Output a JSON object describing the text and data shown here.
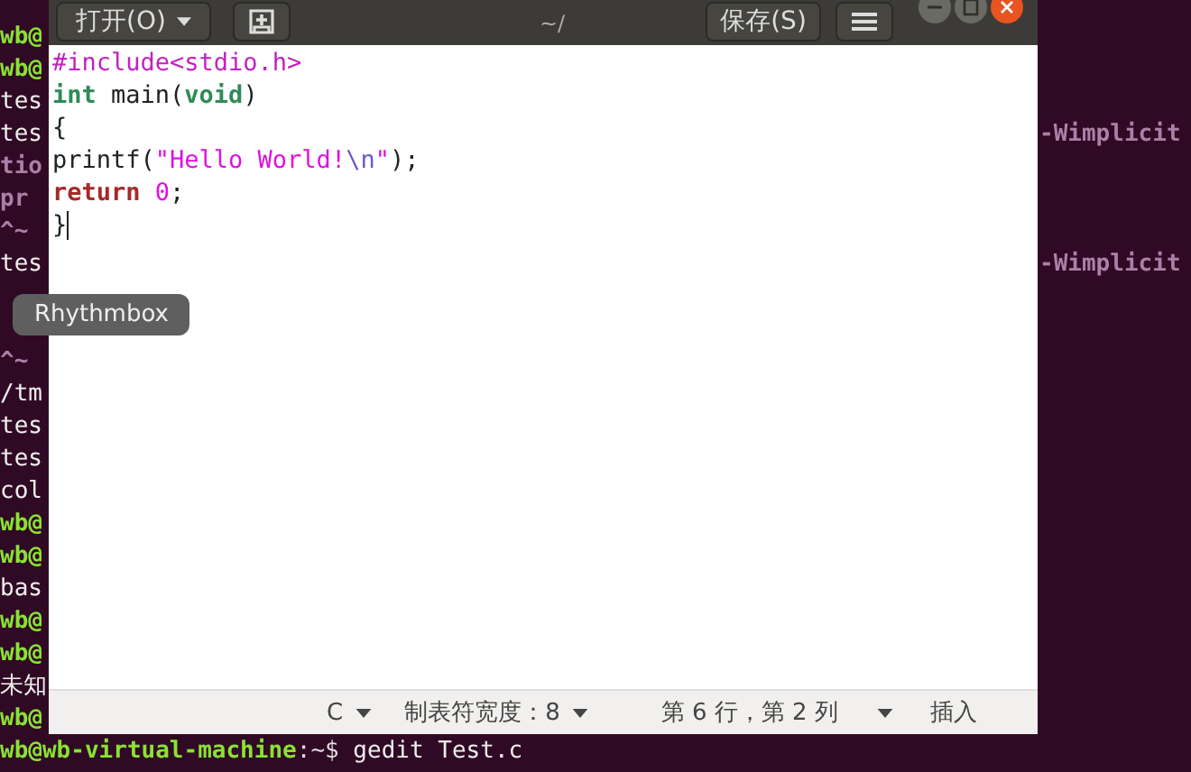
{
  "terminal": {
    "lines": [
      {
        "left": "wb@",
        "kind": "prompt"
      },
      {
        "left": "wb@",
        "kind": "prompt"
      },
      {
        "left": "tes",
        "kind": "text"
      },
      {
        "left": "tes",
        "kind": "text",
        "right": "-Wimplicit"
      },
      {
        "left": "tio",
        "kind": "warning"
      },
      {
        "left": "pr",
        "kind": "warning"
      },
      {
        "left": "^~",
        "kind": "warning"
      },
      {
        "left": "tes",
        "kind": "text",
        "right": "-Wimplicit"
      }
    ],
    "lines_below_tooltip": [
      {
        "left": "^~",
        "kind": "warning"
      },
      {
        "left": "/tm",
        "kind": "text"
      },
      {
        "left": "tes",
        "kind": "text"
      },
      {
        "left": "tes",
        "kind": "text"
      },
      {
        "left": "col",
        "kind": "text"
      },
      {
        "left": "wb@",
        "kind": "prompt"
      },
      {
        "left": "wb@",
        "kind": "prompt"
      },
      {
        "left": "bas",
        "kind": "text"
      },
      {
        "left": "wb@",
        "kind": "prompt"
      },
      {
        "left": "wb@",
        "kind": "prompt"
      },
      {
        "left": "未知",
        "kind": "text"
      },
      {
        "left": "wb@",
        "kind": "prompt"
      }
    ],
    "bottom_line": [
      {
        "text": "wb@wb-virtual-machine",
        "kind": "prompt"
      },
      {
        "text": ":~$",
        "kind": "path"
      },
      {
        "text": " gedit Test.c",
        "kind": "text"
      }
    ]
  },
  "gedit": {
    "open_button": "打开(O)",
    "subtitle": "~/",
    "save_button": "保存(S)",
    "code": [
      {
        "tokens": [
          {
            "text": "#include<stdio.h>",
            "kind": "preproc"
          }
        ]
      },
      {
        "tokens": [
          {
            "text": "int",
            "kind": "type"
          },
          {
            "text": " main(",
            "kind": "plain"
          },
          {
            "text": "void",
            "kind": "type"
          },
          {
            "text": ")",
            "kind": "plain"
          }
        ]
      },
      {
        "tokens": [
          {
            "text": "{",
            "kind": "plain"
          }
        ]
      },
      {
        "tokens": [
          {
            "text": "printf(",
            "kind": "plain"
          },
          {
            "text": "\"Hello World!",
            "kind": "string"
          },
          {
            "text": "\\n",
            "kind": "escape"
          },
          {
            "text": "\"",
            "kind": "string"
          },
          {
            "text": ");",
            "kind": "plain"
          }
        ]
      },
      {
        "tokens": [
          {
            "text": "return",
            "kind": "keyword"
          },
          {
            "text": " 0",
            "kind": "number"
          },
          {
            "text": ";",
            "kind": "plain"
          }
        ]
      },
      {
        "tokens": [
          {
            "text": "}",
            "kind": "plain"
          }
        ],
        "cursor": true
      }
    ],
    "status": {
      "language": "C",
      "tab_width": "制表符宽度：8",
      "position": "第 6 行，第 2 列",
      "mode": "插入"
    }
  },
  "tooltip": "Rhythmbox"
}
